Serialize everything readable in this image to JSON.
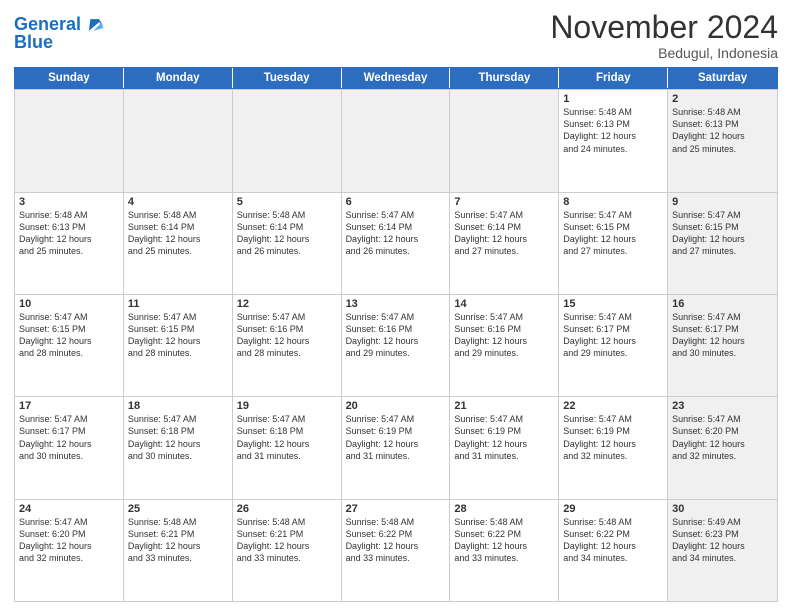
{
  "header": {
    "logo_line1": "General",
    "logo_line2": "Blue",
    "month": "November 2024",
    "location": "Bedugul, Indonesia"
  },
  "days_of_week": [
    "Sunday",
    "Monday",
    "Tuesday",
    "Wednesday",
    "Thursday",
    "Friday",
    "Saturday"
  ],
  "weeks": [
    [
      {
        "day": "",
        "info": "",
        "shaded": true
      },
      {
        "day": "",
        "info": "",
        "shaded": true
      },
      {
        "day": "",
        "info": "",
        "shaded": true
      },
      {
        "day": "",
        "info": "",
        "shaded": true
      },
      {
        "day": "",
        "info": "",
        "shaded": true
      },
      {
        "day": "1",
        "info": "Sunrise: 5:48 AM\nSunset: 6:13 PM\nDaylight: 12 hours\nand 24 minutes.",
        "shaded": false
      },
      {
        "day": "2",
        "info": "Sunrise: 5:48 AM\nSunset: 6:13 PM\nDaylight: 12 hours\nand 25 minutes.",
        "shaded": true
      }
    ],
    [
      {
        "day": "3",
        "info": "Sunrise: 5:48 AM\nSunset: 6:13 PM\nDaylight: 12 hours\nand 25 minutes.",
        "shaded": false
      },
      {
        "day": "4",
        "info": "Sunrise: 5:48 AM\nSunset: 6:14 PM\nDaylight: 12 hours\nand 25 minutes.",
        "shaded": false
      },
      {
        "day": "5",
        "info": "Sunrise: 5:48 AM\nSunset: 6:14 PM\nDaylight: 12 hours\nand 26 minutes.",
        "shaded": false
      },
      {
        "day": "6",
        "info": "Sunrise: 5:47 AM\nSunset: 6:14 PM\nDaylight: 12 hours\nand 26 minutes.",
        "shaded": false
      },
      {
        "day": "7",
        "info": "Sunrise: 5:47 AM\nSunset: 6:14 PM\nDaylight: 12 hours\nand 27 minutes.",
        "shaded": false
      },
      {
        "day": "8",
        "info": "Sunrise: 5:47 AM\nSunset: 6:15 PM\nDaylight: 12 hours\nand 27 minutes.",
        "shaded": false
      },
      {
        "day": "9",
        "info": "Sunrise: 5:47 AM\nSunset: 6:15 PM\nDaylight: 12 hours\nand 27 minutes.",
        "shaded": true
      }
    ],
    [
      {
        "day": "10",
        "info": "Sunrise: 5:47 AM\nSunset: 6:15 PM\nDaylight: 12 hours\nand 28 minutes.",
        "shaded": false
      },
      {
        "day": "11",
        "info": "Sunrise: 5:47 AM\nSunset: 6:15 PM\nDaylight: 12 hours\nand 28 minutes.",
        "shaded": false
      },
      {
        "day": "12",
        "info": "Sunrise: 5:47 AM\nSunset: 6:16 PM\nDaylight: 12 hours\nand 28 minutes.",
        "shaded": false
      },
      {
        "day": "13",
        "info": "Sunrise: 5:47 AM\nSunset: 6:16 PM\nDaylight: 12 hours\nand 29 minutes.",
        "shaded": false
      },
      {
        "day": "14",
        "info": "Sunrise: 5:47 AM\nSunset: 6:16 PM\nDaylight: 12 hours\nand 29 minutes.",
        "shaded": false
      },
      {
        "day": "15",
        "info": "Sunrise: 5:47 AM\nSunset: 6:17 PM\nDaylight: 12 hours\nand 29 minutes.",
        "shaded": false
      },
      {
        "day": "16",
        "info": "Sunrise: 5:47 AM\nSunset: 6:17 PM\nDaylight: 12 hours\nand 30 minutes.",
        "shaded": true
      }
    ],
    [
      {
        "day": "17",
        "info": "Sunrise: 5:47 AM\nSunset: 6:17 PM\nDaylight: 12 hours\nand 30 minutes.",
        "shaded": false
      },
      {
        "day": "18",
        "info": "Sunrise: 5:47 AM\nSunset: 6:18 PM\nDaylight: 12 hours\nand 30 minutes.",
        "shaded": false
      },
      {
        "day": "19",
        "info": "Sunrise: 5:47 AM\nSunset: 6:18 PM\nDaylight: 12 hours\nand 31 minutes.",
        "shaded": false
      },
      {
        "day": "20",
        "info": "Sunrise: 5:47 AM\nSunset: 6:19 PM\nDaylight: 12 hours\nand 31 minutes.",
        "shaded": false
      },
      {
        "day": "21",
        "info": "Sunrise: 5:47 AM\nSunset: 6:19 PM\nDaylight: 12 hours\nand 31 minutes.",
        "shaded": false
      },
      {
        "day": "22",
        "info": "Sunrise: 5:47 AM\nSunset: 6:19 PM\nDaylight: 12 hours\nand 32 minutes.",
        "shaded": false
      },
      {
        "day": "23",
        "info": "Sunrise: 5:47 AM\nSunset: 6:20 PM\nDaylight: 12 hours\nand 32 minutes.",
        "shaded": true
      }
    ],
    [
      {
        "day": "24",
        "info": "Sunrise: 5:47 AM\nSunset: 6:20 PM\nDaylight: 12 hours\nand 32 minutes.",
        "shaded": false
      },
      {
        "day": "25",
        "info": "Sunrise: 5:48 AM\nSunset: 6:21 PM\nDaylight: 12 hours\nand 33 minutes.",
        "shaded": false
      },
      {
        "day": "26",
        "info": "Sunrise: 5:48 AM\nSunset: 6:21 PM\nDaylight: 12 hours\nand 33 minutes.",
        "shaded": false
      },
      {
        "day": "27",
        "info": "Sunrise: 5:48 AM\nSunset: 6:22 PM\nDaylight: 12 hours\nand 33 minutes.",
        "shaded": false
      },
      {
        "day": "28",
        "info": "Sunrise: 5:48 AM\nSunset: 6:22 PM\nDaylight: 12 hours\nand 33 minutes.",
        "shaded": false
      },
      {
        "day": "29",
        "info": "Sunrise: 5:48 AM\nSunset: 6:22 PM\nDaylight: 12 hours\nand 34 minutes.",
        "shaded": false
      },
      {
        "day": "30",
        "info": "Sunrise: 5:49 AM\nSunset: 6:23 PM\nDaylight: 12 hours\nand 34 minutes.",
        "shaded": true
      }
    ]
  ]
}
